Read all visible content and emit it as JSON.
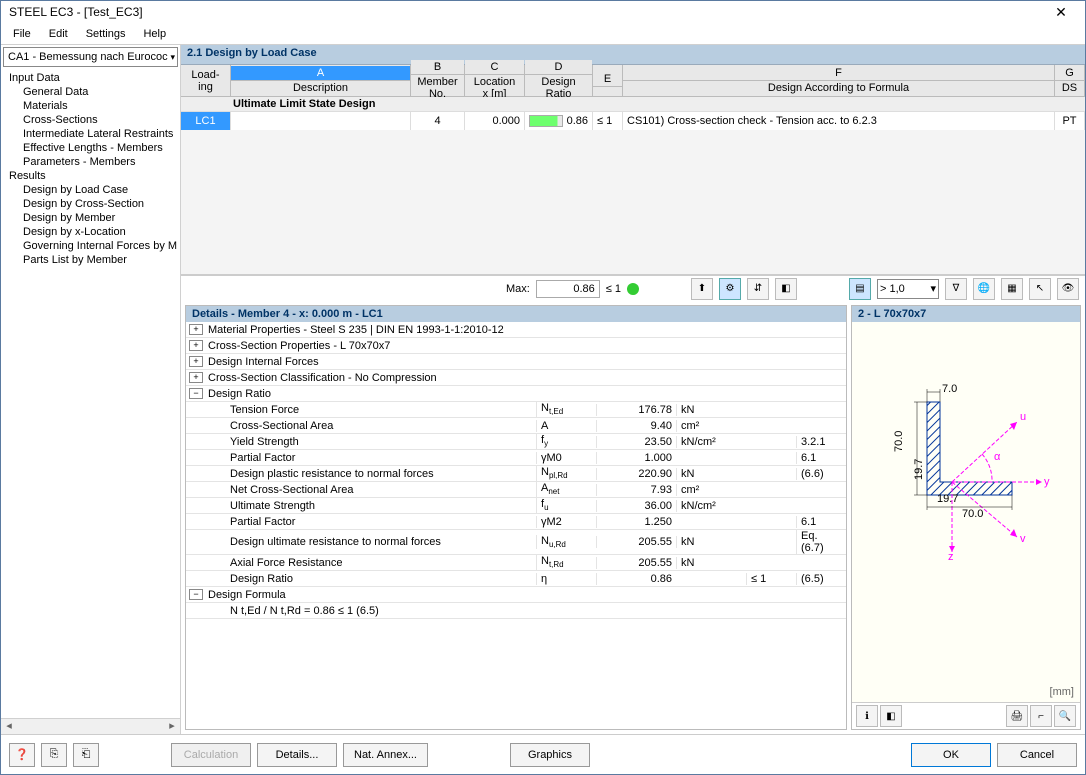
{
  "window": {
    "title": "STEEL EC3 - [Test_EC3]"
  },
  "menu": [
    "File",
    "Edit",
    "Settings",
    "Help"
  ],
  "combo": "CA1 - Bemessung nach Eurococ",
  "tree": {
    "input_header": "Input Data",
    "input": [
      "General Data",
      "Materials",
      "Cross-Sections",
      "Intermediate Lateral Restraints",
      "Effective Lengths - Members",
      "Parameters - Members"
    ],
    "results_header": "Results",
    "results": [
      "Design by Load Case",
      "Design by Cross-Section",
      "Design by Member",
      "Design by x-Location",
      "Governing Internal Forces by M",
      "Parts List by Member"
    ]
  },
  "main_title": "2.1 Design by Load Case",
  "grid": {
    "cols": {
      "load": "Load-\ning",
      "A": "A",
      "B": "B",
      "C": "C",
      "D": "D",
      "E": "E",
      "F": "F",
      "G": "G",
      "desc": "Description",
      "member": "Member\nNo.",
      "loc": "Location\nx [m]",
      "ratio": "Design\nRatio",
      "formula": "Design According to Formula",
      "ds": "DS"
    },
    "group": "Ultimate Limit State Design",
    "row": {
      "lc": "LC1",
      "member": "4",
      "x": "0.000",
      "ratio": "0.86",
      "cond": "≤ 1",
      "formula": "CS101) Cross-section check - Tension acc. to 6.2.3",
      "ds": "PT"
    }
  },
  "maxrow": {
    "label": "Max:",
    "value": "0.86",
    "cond": "≤ 1",
    "scale": "> 1,0"
  },
  "details": {
    "title": "Details - Member 4 - x: 0.000 m - LC1",
    "groups": [
      "Material Properties - Steel S 235 | DIN EN 1993-1-1:2010-12",
      "Cross-Section Properties  -  L 70x70x7",
      "Design Internal Forces",
      "Cross-Section Classification - No Compression"
    ],
    "ratio_header": "Design Ratio",
    "rows": [
      {
        "lbl": "Tension Force",
        "sym": "N t,Ed",
        "val": "176.78",
        "unit": "kN",
        "ref": ""
      },
      {
        "lbl": "Cross-Sectional Area",
        "sym": "A",
        "val": "9.40",
        "unit": "cm2",
        "ref": ""
      },
      {
        "lbl": "Yield Strength",
        "sym": "f y",
        "val": "23.50",
        "unit": "kN/cm2",
        "ref": "3.2.1"
      },
      {
        "lbl": "Partial Factor",
        "sym": "γM0",
        "val": "1.000",
        "unit": "",
        "ref": "6.1"
      },
      {
        "lbl": "Design plastic resistance to normal forces",
        "sym": "N pl,Rd",
        "val": "220.90",
        "unit": "kN",
        "ref": "(6.6)"
      },
      {
        "lbl": "Net Cross-Sectional Area",
        "sym": "A net",
        "val": "7.93",
        "unit": "cm2",
        "ref": ""
      },
      {
        "lbl": "Ultimate Strength",
        "sym": "f u",
        "val": "36.00",
        "unit": "kN/cm2",
        "ref": ""
      },
      {
        "lbl": "Partial Factor",
        "sym": "γM2",
        "val": "1.250",
        "unit": "",
        "ref": "6.1"
      },
      {
        "lbl": "Design ultimate resistance to normal forces",
        "sym": "N u,Rd",
        "val": "205.55",
        "unit": "kN",
        "ref": "Eq. (6.7)"
      },
      {
        "lbl": "Axial Force Resistance",
        "sym": "N t,Rd",
        "val": "205.55",
        "unit": "kN",
        "ref": ""
      },
      {
        "lbl": "Design Ratio",
        "sym": "η",
        "val": "0.86",
        "unit": "",
        "cond": "≤ 1",
        "ref": "(6.5)"
      }
    ],
    "formula_header": "Design Formula",
    "formula": "N t,Ed / N t,Rd = 0.86 ≤ 1   (6.5)"
  },
  "preview": {
    "title": "2 - L 70x70x7",
    "unit": "[mm]",
    "dims": {
      "h": "70.0",
      "w": "70.0",
      "t": "7.0",
      "r1": "19.7",
      "r2": "19.7"
    },
    "axes": [
      "u",
      "α",
      "y",
      "v",
      "z"
    ]
  },
  "footer": {
    "calc": "Calculation",
    "details": "Details...",
    "annex": "Nat. Annex...",
    "graphics": "Graphics",
    "ok": "OK",
    "cancel": "Cancel"
  }
}
